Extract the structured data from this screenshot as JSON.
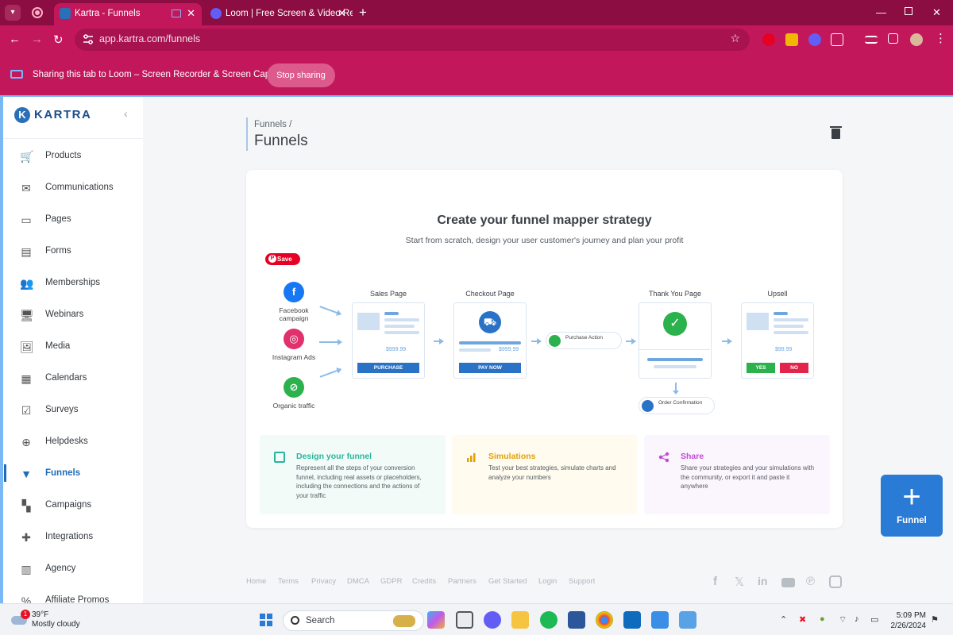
{
  "browser": {
    "tabs": [
      {
        "title": "Kartra - Funnels",
        "active": true
      },
      {
        "title": "Loom | Free Screen & Video Re",
        "active": false
      }
    ],
    "url": "app.kartra.com/funnels"
  },
  "loom_banner": {
    "text": "Sharing this tab to Loom – Screen Recorder & Screen Capture",
    "stop_label": "Stop sharing"
  },
  "sidebar": {
    "brand": "KARTRA",
    "items": [
      {
        "label": "Products",
        "icon": "cart-icon"
      },
      {
        "label": "Communications",
        "icon": "mail-icon"
      },
      {
        "label": "Pages",
        "icon": "page-icon"
      },
      {
        "label": "Forms",
        "icon": "clipboard-icon"
      },
      {
        "label": "Memberships",
        "icon": "people-icon"
      },
      {
        "label": "Webinars",
        "icon": "monitor-icon"
      },
      {
        "label": "Media",
        "icon": "photo-icon"
      },
      {
        "label": "Calendars",
        "icon": "calendar-icon"
      },
      {
        "label": "Surveys",
        "icon": "checkbox-icon"
      },
      {
        "label": "Helpdesks",
        "icon": "lifebuoy-icon"
      },
      {
        "label": "Funnels",
        "icon": "filter-icon",
        "active": true
      },
      {
        "label": "Campaigns",
        "icon": "blocks-icon"
      },
      {
        "label": "Integrations",
        "icon": "puzzle-icon"
      },
      {
        "label": "Agency",
        "icon": "building-icon"
      },
      {
        "label": "Affiliate Promos",
        "icon": "percent-icon"
      }
    ]
  },
  "header": {
    "breadcrumb": "Funnels /",
    "title": "Funnels"
  },
  "card": {
    "heading": "Create your funnel mapper strategy",
    "subheading": "Start from scratch, design your user customer's journey and plan your profit",
    "save_label": "Save",
    "sources": [
      {
        "label": "Facebook campaign",
        "color": "#1877f2",
        "glyph": "f"
      },
      {
        "label": "Instagram Ads",
        "color": "#e1306c",
        "glyph": "◎"
      },
      {
        "label": "Organic traffic",
        "color": "#2bb24c",
        "glyph": "⊘"
      }
    ],
    "stages": {
      "sales": {
        "title": "Sales Page",
        "price": "$999.99",
        "button": "PURCHASE"
      },
      "checkout": {
        "title": "Checkout Page",
        "price": "$999.99",
        "button": "PAY NOW"
      },
      "purchase_action": "Purchase Action",
      "thankyou": {
        "title": "Thank You Page"
      },
      "order_confirmation": "Order Confirmation",
      "upsell": {
        "title": "Upsell",
        "price": "$99.99",
        "yes": "YES",
        "no": "NO"
      }
    },
    "features": [
      {
        "title": "Design your funnel",
        "text": "Represent all the steps of your conversion funnel, including real assets or placeholders, including the connections and the actions of your traffic",
        "color": "#2ab59b",
        "bg": "#f2fbf8"
      },
      {
        "title": "Simulations",
        "text": "Test your best strategies, simulate charts and analyze your numbers",
        "color": "#e3a008",
        "bg": "#fffbee"
      },
      {
        "title": "Share",
        "text": "Share your strategies and your simulations with the community, or export it and paste it anywhere",
        "color": "#c04ad6",
        "bg": "#fbf5fd"
      }
    ]
  },
  "fab": {
    "label": "Funnel"
  },
  "footer": {
    "links": [
      "Home",
      "Terms",
      "Privacy",
      "DMCA",
      "GDPR",
      "Credits",
      "Partners",
      "Get Started",
      "Login",
      "Support"
    ]
  },
  "taskbar": {
    "weather_temp": "39°F",
    "weather_desc": "Mostly cloudy",
    "weather_badge": "1",
    "search_placeholder": "Search",
    "time": "5:09 PM",
    "date": "2/26/2024"
  }
}
